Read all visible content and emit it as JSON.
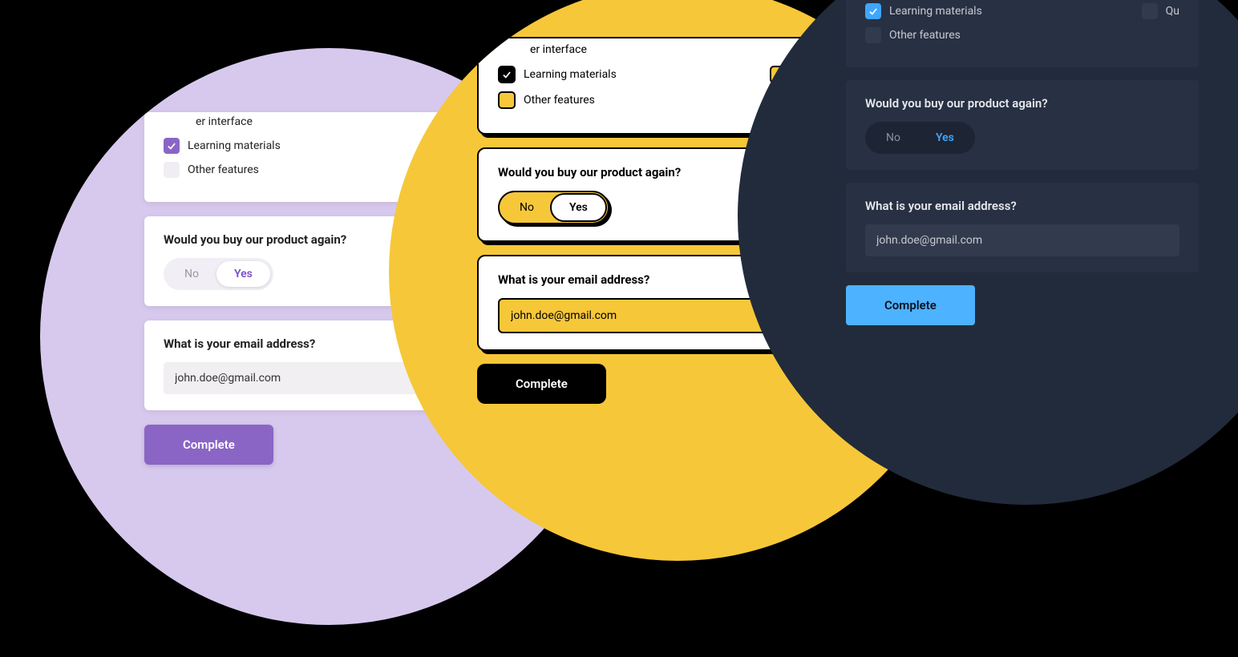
{
  "checkboxes": {
    "interface": "Interface",
    "learning_materials": "Learning materials",
    "other_features": "Other features",
    "qu_partial": "Qu"
  },
  "question_buy_again": "Would you buy our product again?",
  "toggle": {
    "no": "No",
    "yes": "Yes"
  },
  "question_email": "What is your email address?",
  "email_value": "john.doe@gmail.com",
  "complete_label": "Complete",
  "interface_partial": "er interface"
}
